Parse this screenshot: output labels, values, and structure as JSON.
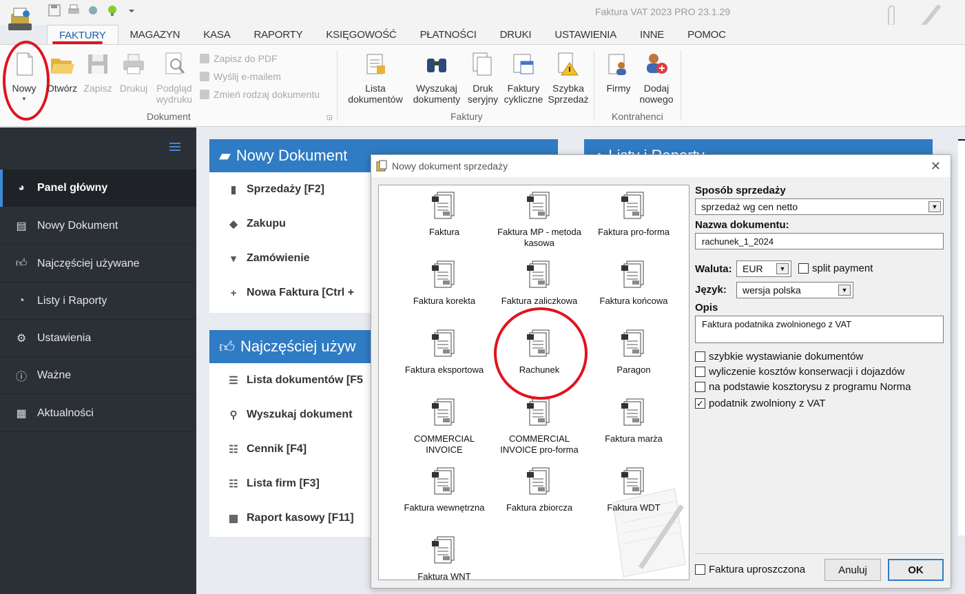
{
  "window": {
    "title": "Faktura VAT 2023 PRO 23.1.29"
  },
  "menu": {
    "tabs": [
      {
        "label": "FAKTURY"
      },
      {
        "label": "MAGAZYN"
      },
      {
        "label": "KASA"
      },
      {
        "label": "RAPORTY"
      },
      {
        "label": "KSIĘGOWOŚĆ"
      },
      {
        "label": "PŁATNOŚCI"
      },
      {
        "label": "DRUKI"
      },
      {
        "label": "USTAWIENIA"
      },
      {
        "label": "INNE"
      },
      {
        "label": "POMOC"
      }
    ]
  },
  "ribbon": {
    "nowy": "Nowy",
    "otworz": "Otwórz",
    "zapisz": "Zapisz",
    "drukuj": "Drukuj",
    "podglad_1": "Podgląd",
    "podglad_2": "wydruku",
    "zapisz_pdf": "Zapisz do PDF",
    "wyslij": "Wyślij e-mailem",
    "zmien": "Zmień rodzaj dokumentu",
    "group_dokument": "Dokument",
    "lista_1": "Lista",
    "lista_2": "dokumentów",
    "wyszukaj_1": "Wyszukaj",
    "wyszukaj_2": "dokumenty",
    "druk_1": "Druk",
    "druk_2": "seryjny",
    "cykl_1": "Faktury",
    "cykl_2": "cykliczne",
    "szybka_1": "Szybka",
    "szybka_2": "Sprzedaż",
    "group_faktury": "Faktury",
    "firmy": "Firmy",
    "dodaj_1": "Dodaj",
    "dodaj_2": "nowego",
    "group_kontrahenci": "Kontrahenci"
  },
  "sidebar": {
    "items": [
      {
        "label": "Panel główny"
      },
      {
        "label": "Nowy Dokument"
      },
      {
        "label": "Najczęściej używane"
      },
      {
        "label": "Listy i Raporty"
      },
      {
        "label": "Ustawienia"
      },
      {
        "label": "Ważne"
      },
      {
        "label": "Aktualności"
      }
    ]
  },
  "panels": {
    "nowy": {
      "title": "Nowy Dokument",
      "rows": [
        "Sprzedaży [F2]",
        "Zakupu",
        "Zamówienie",
        "Nowa Faktura [Ctrl +"
      ]
    },
    "czeste": {
      "title": "Najczęściej używ",
      "rows": [
        "Lista dokumentów [F5",
        "Wyszukaj dokument",
        "Cennik [F4]",
        "Lista firm [F3]",
        "Raport kasowy [F11]"
      ]
    },
    "listy": {
      "title": "Listy i Raporty"
    }
  },
  "dialog": {
    "title": "Nowy dokument sprzedaży",
    "docs": [
      "Faktura",
      "Faktura MP - metoda kasowa",
      "Faktura pro-forma",
      "Faktura korekta",
      "Faktura zaliczkowa",
      "Faktura końcowa",
      "Faktura eksportowa",
      "Rachunek",
      "Paragon",
      "COMMERCIAL INVOICE",
      "COMMERCIAL INVOICE pro-forma",
      "Faktura marża",
      "Faktura wewnętrzna",
      "Faktura zbiorcza",
      "Faktura WDT",
      "Faktura WNT"
    ],
    "sposob_label": "Sposób sprzedaży",
    "sposob_value": "sprzedaż wg cen netto",
    "nazwa_label": "Nazwa dokumentu:",
    "nazwa_value": "rachunek_1_2024",
    "waluta_label": "Waluta:",
    "waluta_value": "EUR",
    "split_label": "split payment",
    "jezyk_label": "Język:",
    "jezyk_value": "wersja polska",
    "opis_label": "Opis",
    "opis_value": "Faktura podatnika zwolnionego z VAT",
    "options": [
      {
        "label": "szybkie wystawianie dokumentów",
        "checked": false
      },
      {
        "label": "wyliczenie kosztów konserwacji i dojazdów",
        "checked": false
      },
      {
        "label": "na podstawie kosztorysu z programu Norma",
        "checked": false
      },
      {
        "label": "podatnik zwolniony z VAT",
        "checked": true
      }
    ],
    "uproszczona_label": "Faktura uproszczona",
    "cancel_label": "Anuluj",
    "ok_label": "OK"
  }
}
